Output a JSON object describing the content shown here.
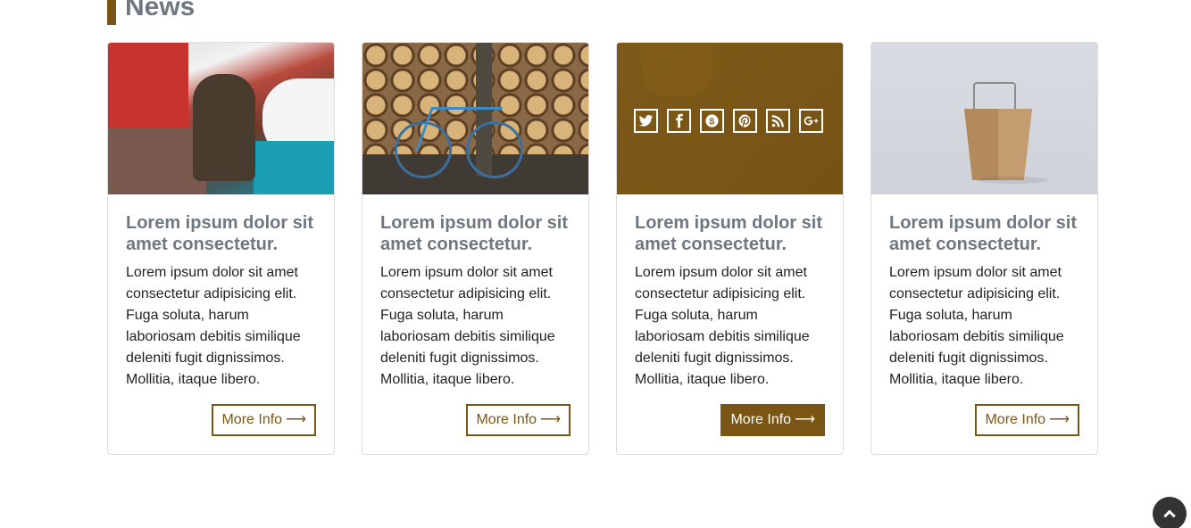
{
  "section": {
    "title": "News"
  },
  "cards": [
    {
      "title": "Lorem ipsum dolor sit amet consectetur.",
      "text": "Lorem ipsum dolor sit amet consectetur adipisicing elit. Fuga soluta, harum laboriosam debitis similique deleniti fugit dignissimos. Mollitia, itaque libero.",
      "button_label": "More Info",
      "image": "woodcutter-in-snow-photo"
    },
    {
      "title": "Lorem ipsum dolor sit amet consectetur.",
      "text": "Lorem ipsum dolor sit amet consectetur adipisicing elit. Fuga soluta, harum laboriosam debitis similique deleniti fugit dignissimos. Mollitia, itaque libero.",
      "button_label": "More Info",
      "image": "bicycle-against-logs-photo"
    },
    {
      "title": "Lorem ipsum dolor sit amet consectetur.",
      "text": "Lorem ipsum dolor sit amet consectetur adipisicing elit. Fuga soluta, harum laboriosam debitis similique deleniti fugit dignissimos. Mollitia, itaque libero.",
      "button_label": "More Info",
      "image": "chainsaw-photo-with-overlay",
      "social_icons": [
        "twitter-icon",
        "facebook-icon",
        "skype-icon",
        "pinterest-icon",
        "rss-icon",
        "google-plus-icon"
      ]
    },
    {
      "title": "Lorem ipsum dolor sit amet consectetur.",
      "text": "Lorem ipsum dolor sit amet consectetur adipisicing elit. Fuga soluta, harum laboriosam debitis similique deleniti fugit dignissimos. Mollitia, itaque libero.",
      "button_label": "More Info",
      "image": "takeout-box-photo"
    }
  ],
  "colors": {
    "accent": "#7a5514",
    "title_gray": "#6f7780",
    "text": "#222222",
    "border": "#dcdcdc"
  },
  "scroll_top": {
    "icon": "chevron-up-icon"
  }
}
